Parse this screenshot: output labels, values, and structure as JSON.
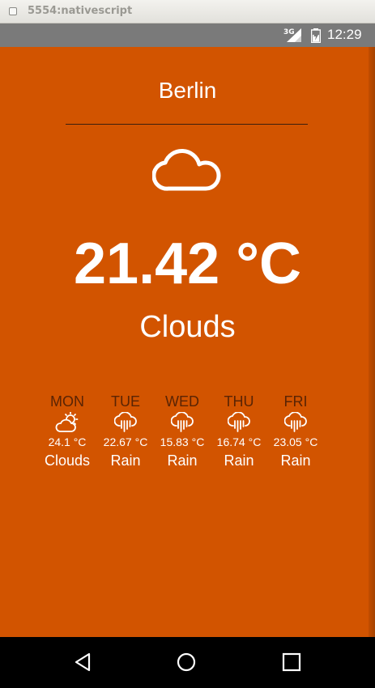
{
  "window": {
    "title": "5554:nativescript"
  },
  "status_bar": {
    "network": "3G",
    "time": "12:29"
  },
  "weather": {
    "city": "Berlin",
    "icon": "cloud-icon",
    "temperature": "21.42 °C",
    "condition": "Clouds"
  },
  "forecast": [
    {
      "day": "MON",
      "icon": "partly-cloudy-icon",
      "temp": "24.1 °C",
      "condition": "Clouds"
    },
    {
      "day": "TUE",
      "icon": "rain-icon",
      "temp": "22.67 °C",
      "condition": "Rain"
    },
    {
      "day": "WED",
      "icon": "rain-icon",
      "temp": "15.83 °C",
      "condition": "Rain"
    },
    {
      "day": "THU",
      "icon": "rain-icon",
      "temp": "16.74 °C",
      "condition": "Rain"
    },
    {
      "day": "FRI",
      "icon": "rain-icon",
      "temp": "23.05 °C",
      "condition": "Rain"
    }
  ],
  "colors": {
    "background": "#d25400",
    "day_label": "#5a2404",
    "text": "#ffffff"
  },
  "nav_bar": {
    "icons": [
      "back-icon",
      "home-icon",
      "recents-icon"
    ]
  }
}
